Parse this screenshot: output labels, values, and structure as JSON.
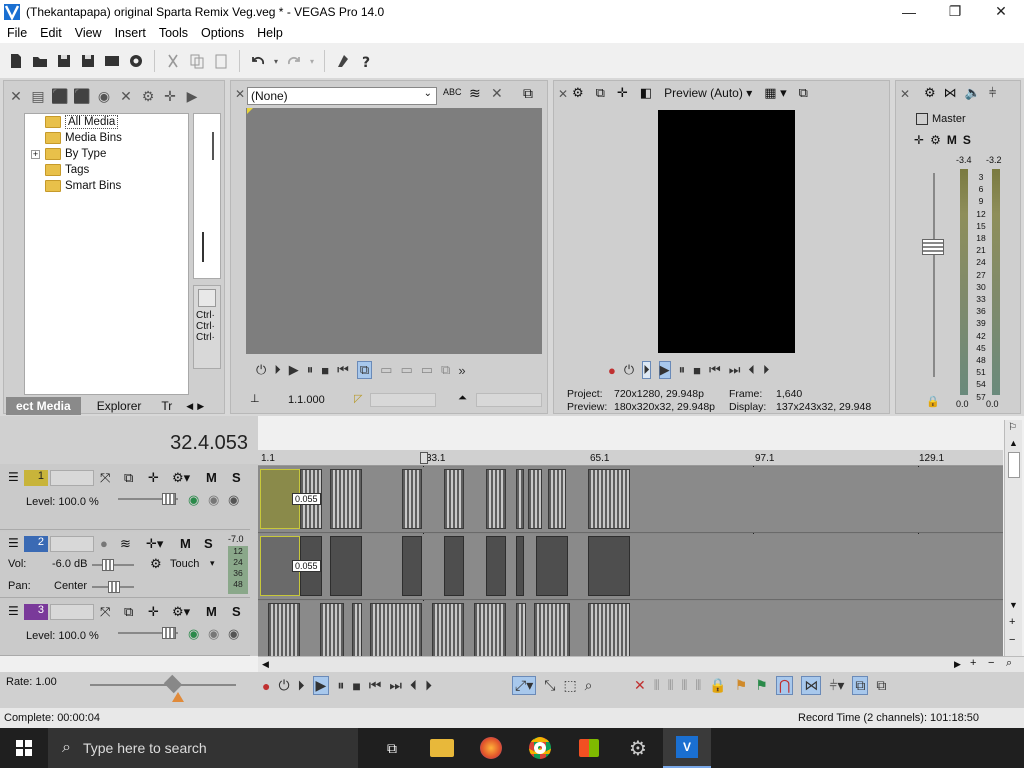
{
  "window": {
    "title": "(Thekantapapa) original Sparta Remix Veg.veg * - VEGAS Pro 14.0",
    "controls": [
      "—",
      "❐",
      "✕"
    ]
  },
  "menu": [
    "File",
    "Edit",
    "View",
    "Insert",
    "Tools",
    "Options",
    "Help"
  ],
  "project_media": {
    "tree": [
      "All Media",
      "Media Bins",
      "By Type",
      "Tags",
      "Smart Bins"
    ],
    "tabs": [
      "ect Media",
      "Explorer",
      "Tr"
    ],
    "shortcut_labels": [
      "Ctrl·",
      "Ctrl·",
      "Ctrl·"
    ]
  },
  "trimmer": {
    "dropdown_value": "(None)",
    "timecode": "1.1.000"
  },
  "preview": {
    "mode": "Preview (Auto)",
    "project_label": "Project:",
    "project_value": "720x1280, 29.948p",
    "preview_label": "Preview:",
    "preview_value": "180x320x32, 29.948p",
    "frame_label": "Frame:",
    "frame_value": "1,640",
    "display_label": "Display:",
    "display_value": "137x243x32, 29.948"
  },
  "master": {
    "label": "Master",
    "peak_left": "-3.4",
    "peak_right": "-3.2",
    "scale": [
      "3",
      "6",
      "9",
      "12",
      "15",
      "18",
      "21",
      "24",
      "27",
      "30",
      "33",
      "36",
      "39",
      "42",
      "45",
      "48",
      "51",
      "54",
      "57"
    ],
    "bottom_left": "0.0",
    "bottom_right": "0.0"
  },
  "timeline": {
    "timecode": "32.4.053",
    "ruler": [
      "1.1",
      "33.1",
      "65.1",
      "97.1",
      "129.1"
    ],
    "tracks": [
      {
        "number": "1",
        "type": "video",
        "level": "Level: 100.0 %",
        "color": "#c8b43a"
      },
      {
        "number": "2",
        "type": "audio",
        "vol": "Vol:",
        "vol_value": "-6.0 dB",
        "pan": "Pan:",
        "pan_value": "Center",
        "mode": "Touch",
        "meter_top": "-7.0",
        "meter_scale": [
          "12",
          "24",
          "36",
          "48"
        ],
        "color": "#3a6ab4"
      },
      {
        "number": "3",
        "type": "video",
        "level": "Level: 100.0 %",
        "color": "#7a3a9a"
      }
    ],
    "clip_labels": [
      "0.055",
      "0.055"
    ],
    "mute": "M",
    "solo": "S"
  },
  "transport": {
    "rate": "Rate: 1.00"
  },
  "status": {
    "complete": "Complete: 00:00:04",
    "record_time": "Record Time (2 channels): 101:18:50"
  },
  "taskbar": {
    "search_placeholder": "Type here to search"
  },
  "colors": {
    "accent_blue": "#3a7bd5",
    "play_highlight": "#a8c8ec"
  }
}
